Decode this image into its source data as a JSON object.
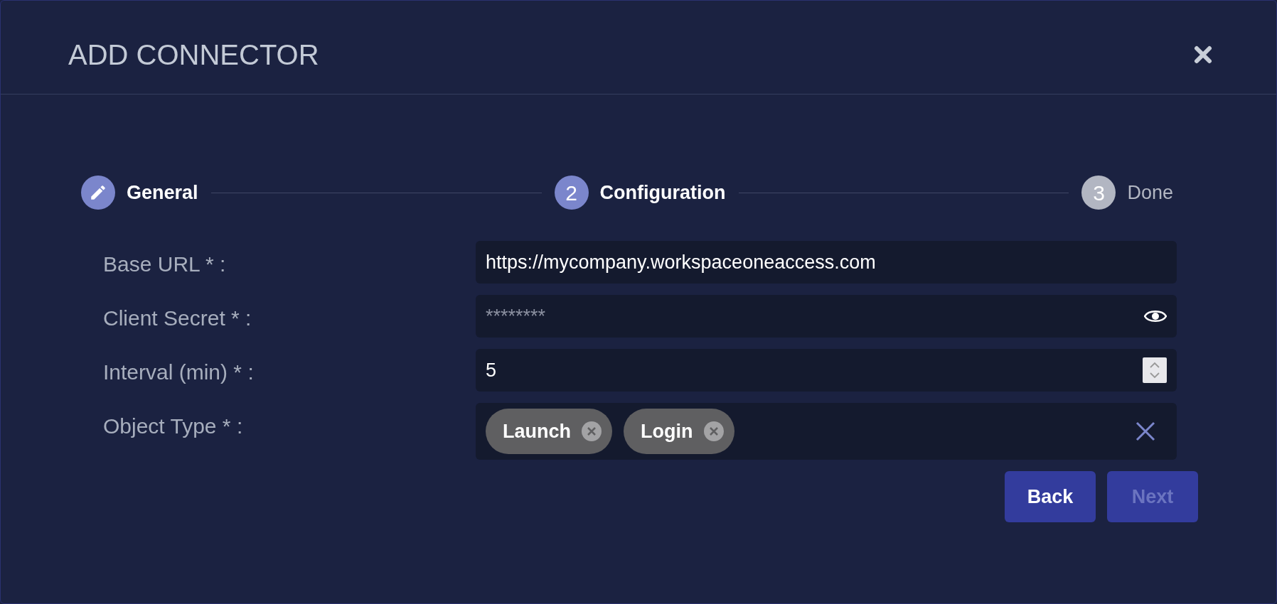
{
  "dialog": {
    "title": "ADD CONNECTOR"
  },
  "steps": [
    {
      "label": "General",
      "kind": "completed"
    },
    {
      "label": "Configuration",
      "kind": "active",
      "number": "2"
    },
    {
      "label": "Done",
      "kind": "pending",
      "number": "3"
    }
  ],
  "fields": [
    {
      "kind": "text",
      "label": "Base URL * :",
      "value": "https://mycompany.workspaceoneaccess.com"
    },
    {
      "kind": "password",
      "label": "Client Secret * :",
      "value": "********"
    },
    {
      "kind": "number",
      "label": "Interval (min) * :",
      "value": "5"
    },
    {
      "kind": "tags",
      "label": "Object Type * :",
      "tags": [
        "Launch",
        "Login"
      ]
    }
  ],
  "buttons": [
    {
      "label": "Back",
      "disabled": false
    },
    {
      "label": "Next",
      "disabled": true
    }
  ]
}
